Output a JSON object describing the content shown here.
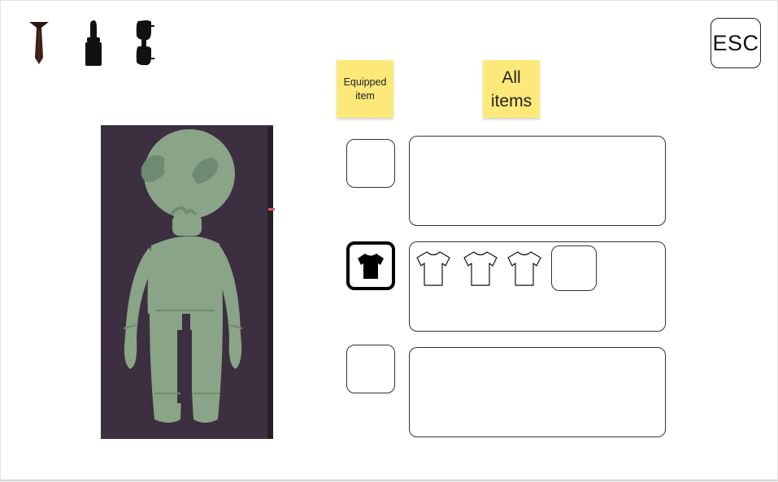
{
  "categories": [
    {
      "id": "tie",
      "icon": "tie-icon",
      "color": "#3a1e14"
    },
    {
      "id": "lipstick",
      "icon": "lipstick-icon",
      "color": "#111111"
    },
    {
      "id": "sunglasses",
      "icon": "sunglasses-icon",
      "color": "#111111"
    }
  ],
  "esc_button": {
    "label": "ESC"
  },
  "labels": {
    "equipped": "Equipped item",
    "all_items": "All items"
  },
  "avatar": {
    "icon": "alien-avatar",
    "background": "#3c2f40",
    "body_color": "#8aa487",
    "face_color": "#6e8a72"
  },
  "rows": [
    {
      "equipped": null,
      "selected": false,
      "items": []
    },
    {
      "equipped": "tshirt-black-icon",
      "selected": true,
      "items": [
        "tshirt-outline-icon",
        "tshirt-outline-icon",
        "tshirt-outline-icon"
      ],
      "has_empty_slot": true
    },
    {
      "equipped": null,
      "selected": false,
      "items": []
    }
  ]
}
